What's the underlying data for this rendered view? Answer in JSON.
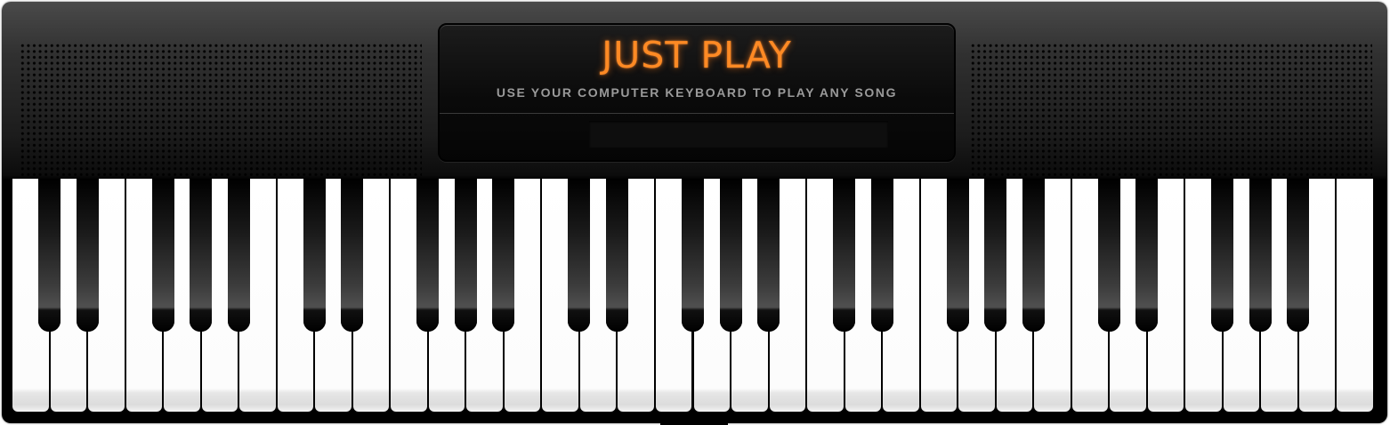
{
  "app": {
    "display": {
      "title": "JUST PLAY",
      "subtitle": "USE YOUR COMPUTER KEYBOARD TO PLAY ANY SONG"
    },
    "keyboard": {
      "white_key_count": 36,
      "black_key_pattern_per_octave": [
        1,
        1,
        0,
        1,
        1,
        1,
        0
      ],
      "octaves": 5
    },
    "colors": {
      "accent": "#ff8a24",
      "body": "#1c1c1c",
      "white_key": "#ffffff",
      "black_key": "#000000",
      "subtitle": "#9a9a9a"
    }
  }
}
